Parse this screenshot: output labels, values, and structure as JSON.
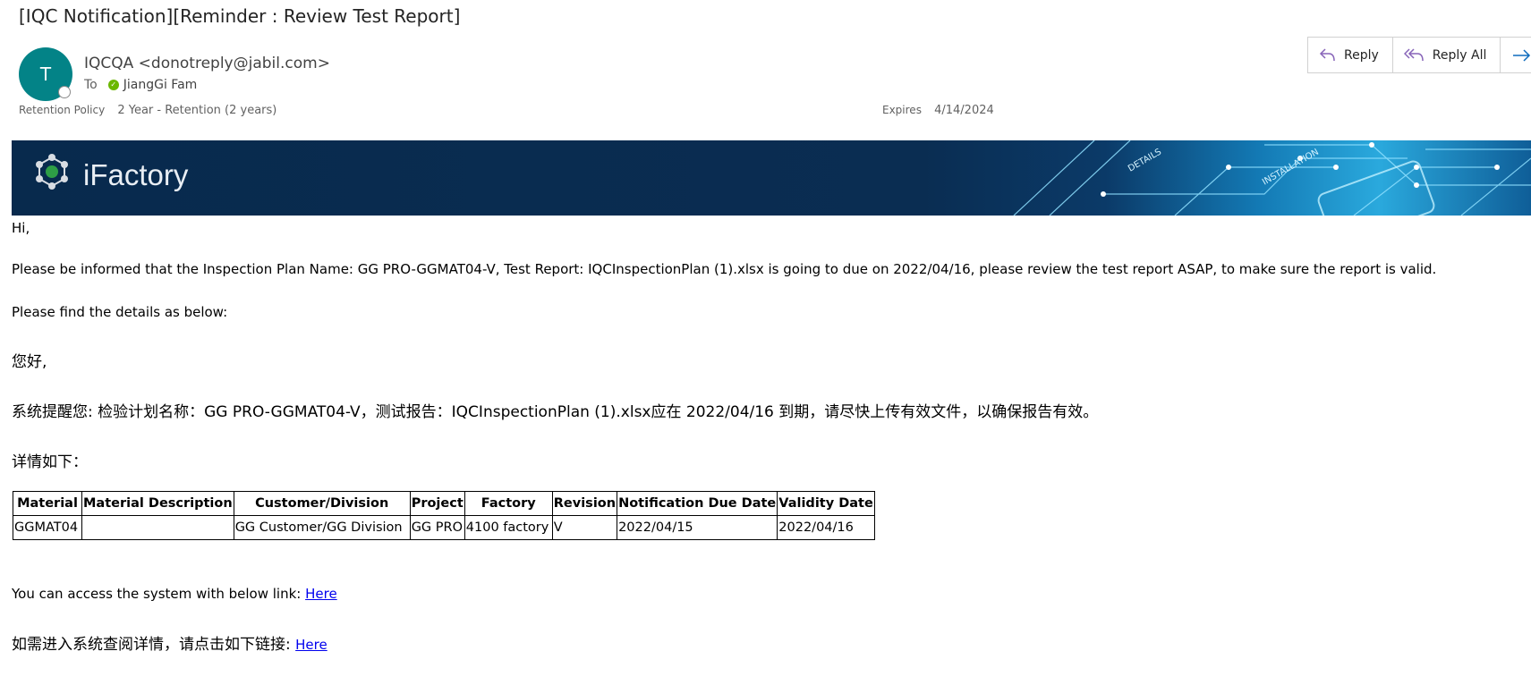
{
  "email": {
    "subject": "[IQC Notification][Reminder : Review Test Report]",
    "avatar_initial": "T",
    "sender": "IQCQA <donotreply@jabil.com>",
    "to_label": "To",
    "recipient": "JiangGi Fam",
    "retention_label": "Retention Policy",
    "retention_value": "2 Year - Retention (2 years)",
    "expires_label": "Expires",
    "expires_value": "4/14/2024"
  },
  "actions": {
    "reply": "Reply",
    "reply_all": "Reply All"
  },
  "banner": {
    "brand": "iFactory",
    "overlay_words": [
      "DETAILS",
      "INSTALLATION"
    ]
  },
  "body": {
    "greeting_en": "Hi,",
    "info_en": "Please be informed that the Inspection Plan Name: GG PRO-GGMAT04-V, Test Report: IQCInspectionPlan (1).xlsx is going to due on 2022/04/16, please review the test report ASAP, to make sure the report is valid.",
    "details_en": "Please find the details as below:",
    "greeting_cn": "您好,",
    "info_cn": "系统提醒您: 检验计划名称：GG PRO-GGMAT04-V，测试报告：IQCInspectionPlan (1).xlsx应在 2022/04/16 到期，请尽快上传有效文件，以确保报告有效。",
    "details_cn": "详情如下：",
    "access_en": "You can access the system with below link: ",
    "access_cn": "如需进入系统查阅详情，请点击如下链接: ",
    "link_text": "Here"
  },
  "table": {
    "headers": [
      "Material",
      "Material Description",
      "Customer/Division",
      "Project",
      "Factory",
      "Revision",
      "Notification Due Date",
      "Validity Date"
    ],
    "rows": [
      [
        "GGMAT04",
        "",
        "GG Customer/GG Division",
        "GG PRO",
        "4100 factory",
        "V",
        "2022/04/15",
        "2022/04/16"
      ]
    ]
  },
  "colors": {
    "avatar": "#038387",
    "banner_dark": "#082a4d",
    "banner_accent": "#2aa9dd",
    "link": "#0000ee",
    "reply_icon": "#8764b8"
  }
}
